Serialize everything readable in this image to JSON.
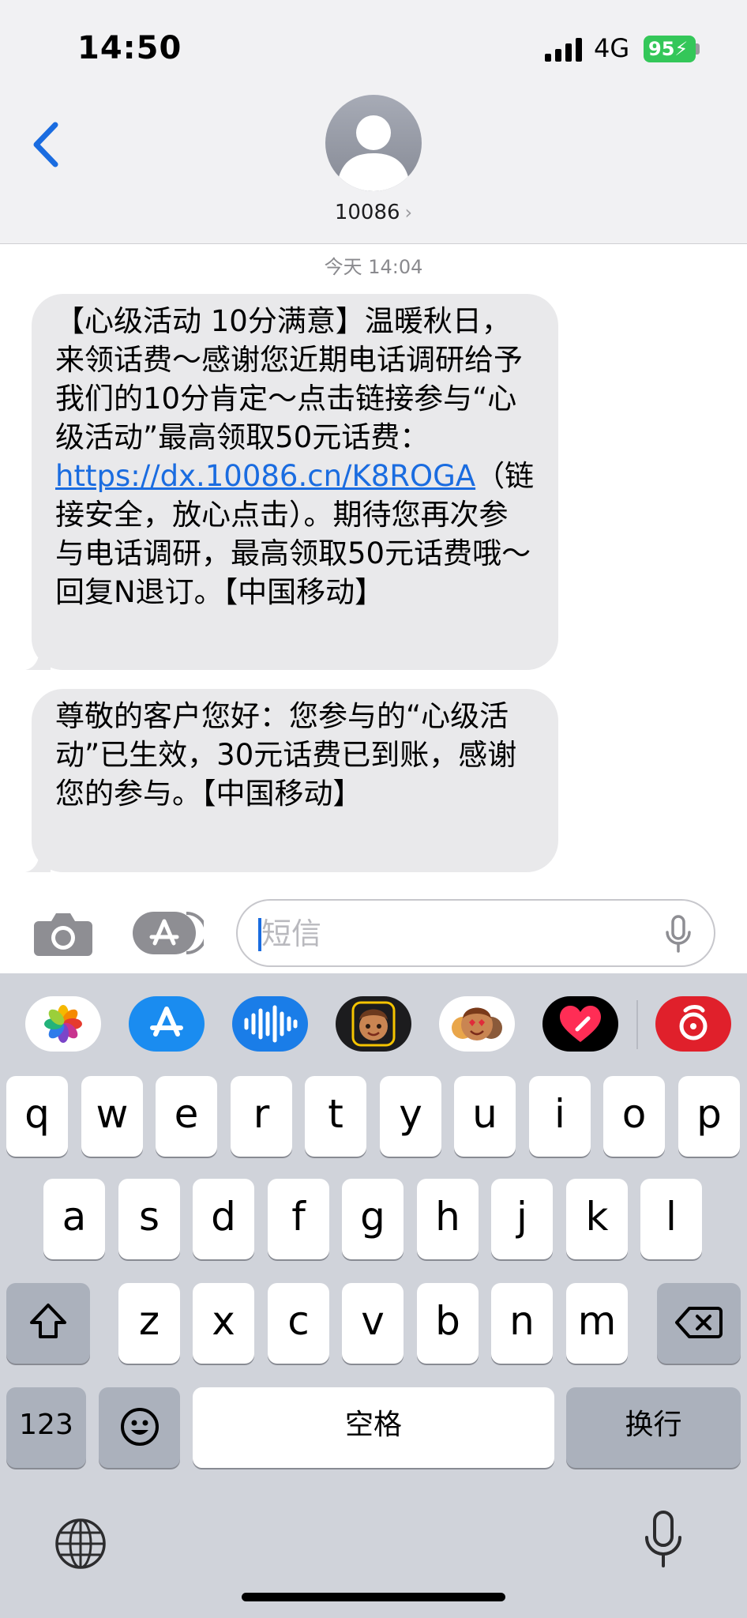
{
  "status_bar": {
    "time": "14:50",
    "network": "4G",
    "battery": "95"
  },
  "header": {
    "contact": "10086"
  },
  "thread": {
    "timestamp": "今天 14:04",
    "messages": [
      {
        "before": "【心级活动 10分满意】温暖秋日，来领话费～感谢您近期电话调研给予我们的10分肯定～点击链接参与“心级活动”最高领取50元话费：",
        "link": "https://dx.10086.cn/K8ROGA",
        "after": "（链接安全，放心点击）。期待您再次参与电话调研，最高领取50元话费哦～回复N退订。【中国移动】"
      },
      {
        "text": "尊敬的客户您好：您参与的“心级活动”已生效，30元话费已到账，感谢您的参与。【中国移动】"
      }
    ]
  },
  "compose": {
    "placeholder": "短信"
  },
  "app_strip": [
    "photos-app",
    "app-store-app",
    "audio-messages-app",
    "memoji-app",
    "memoji-stickers-app",
    "digital-touch-app",
    "netease-music-app"
  ],
  "keyboard": {
    "row1": [
      "q",
      "w",
      "e",
      "r",
      "t",
      "y",
      "u",
      "i",
      "o",
      "p"
    ],
    "row2": [
      "a",
      "s",
      "d",
      "f",
      "g",
      "h",
      "j",
      "k",
      "l"
    ],
    "row3": [
      "z",
      "x",
      "c",
      "v",
      "b",
      "n",
      "m"
    ],
    "numbers_key": "123",
    "space_key": "空格",
    "return_key": "换行"
  },
  "colors": {
    "link": "#1a6ce0",
    "bubble": "#e9e9eb",
    "battery": "#34c759"
  }
}
